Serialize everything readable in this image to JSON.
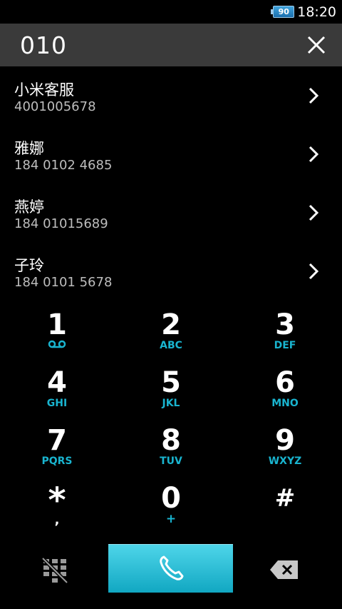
{
  "status": {
    "battery": "90",
    "time": "18:20"
  },
  "dial_input": {
    "value": "010"
  },
  "results": [
    {
      "name": "小米客服",
      "phone": "4001005678"
    },
    {
      "name": "雅娜",
      "phone": "184 0102 4685"
    },
    {
      "name": "燕婷",
      "phone": "184 01015689"
    },
    {
      "name": "子玲",
      "phone": "184 0101 5678"
    }
  ],
  "keypad": [
    {
      "digit": "1",
      "letters": ""
    },
    {
      "digit": "2",
      "letters": "ABC"
    },
    {
      "digit": "3",
      "letters": "DEF"
    },
    {
      "digit": "4",
      "letters": "GHI"
    },
    {
      "digit": "5",
      "letters": "JKL"
    },
    {
      "digit": "6",
      "letters": "MNO"
    },
    {
      "digit": "7",
      "letters": "PQRS"
    },
    {
      "digit": "8",
      "letters": "TUV"
    },
    {
      "digit": "9",
      "letters": "WXYZ"
    },
    {
      "digit": "*",
      "letters": ","
    },
    {
      "digit": "0",
      "letters": "+"
    },
    {
      "digit": "#",
      "letters": ""
    }
  ],
  "icons": {
    "clear": "close-icon",
    "voicemail": "voicemail-icon",
    "chevron": "chevron-right-icon",
    "dialpad_toggle": "dialpad-hide-icon",
    "call": "phone-icon",
    "backspace": "backspace-icon"
  },
  "colors": {
    "accent": "#19b4cf",
    "call_button": "#2fc3dc",
    "search_bar": "#3a3a3a"
  }
}
